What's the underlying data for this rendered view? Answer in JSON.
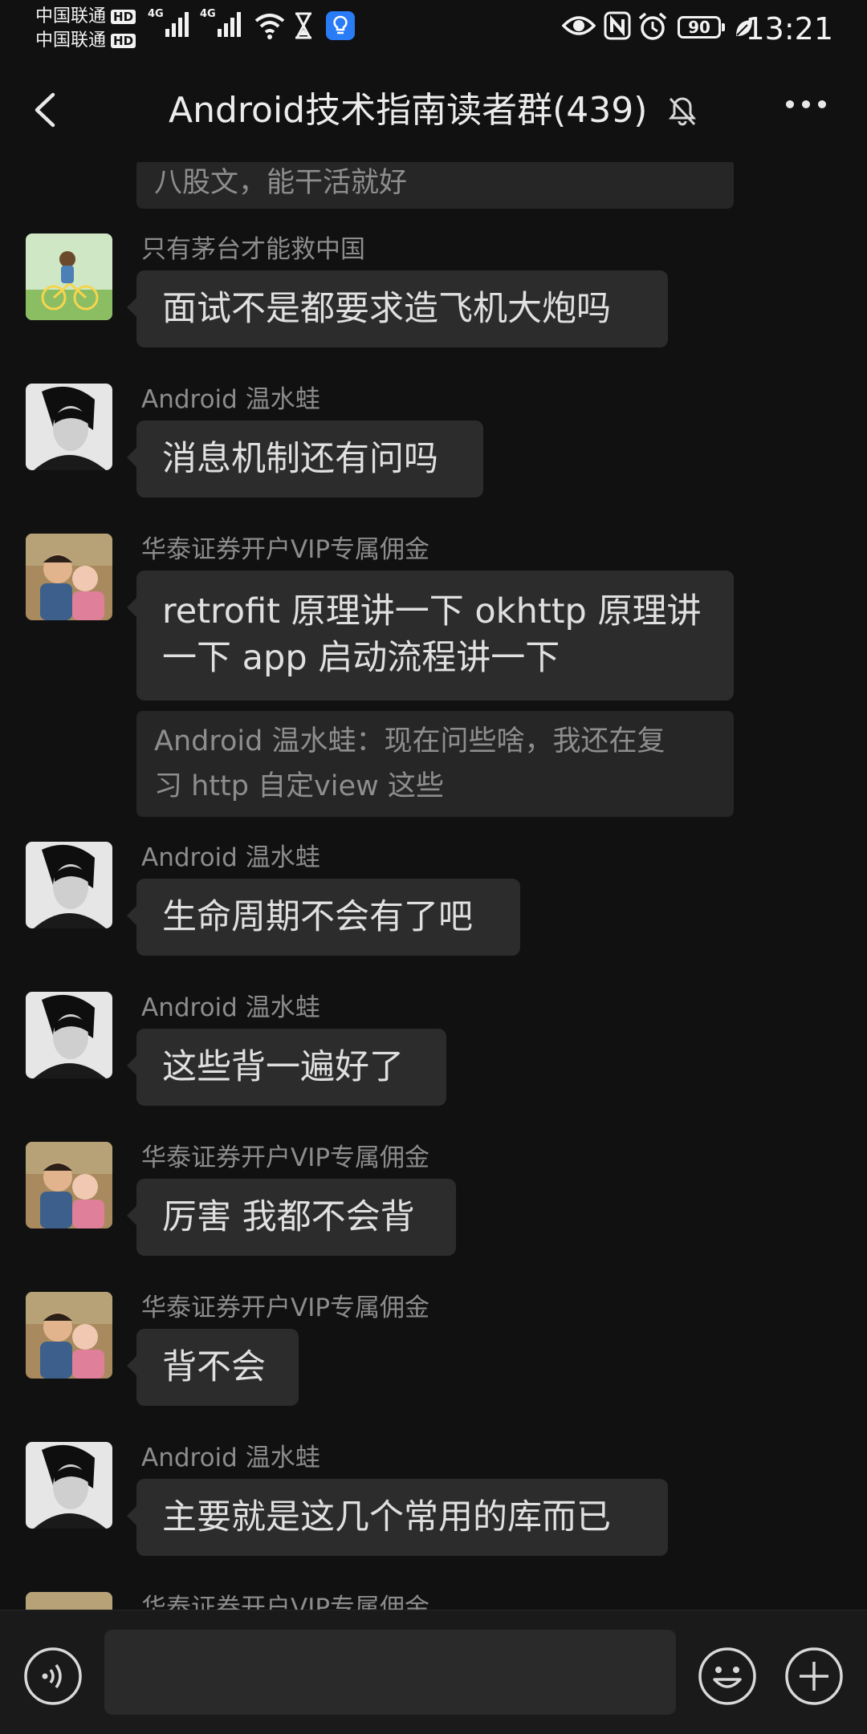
{
  "status_bar": {
    "carrier_1": "中国联通",
    "carrier_2": "中国联通",
    "hd_badge": "HD",
    "network_1": "4G",
    "network_2": "4G",
    "battery": "90",
    "time": "13:21",
    "icons": [
      "wifi-icon",
      "hourglass-icon",
      "bulb-icon",
      "eye-icon",
      "nfc-icon",
      "alarm-icon",
      "battery-icon",
      "leaf-icon"
    ]
  },
  "header": {
    "title": "Android技术指南读者群(439)",
    "icons": [
      "back-icon",
      "mute-bell-icon",
      "more-icon"
    ]
  },
  "messages": [
    {
      "type": "quote",
      "text": "八股文，能干活就好"
    },
    {
      "type": "message",
      "sender": "只有茅台才能救中国",
      "avatar": "avatar-child-bike",
      "text": "面试不是都要求造飞机大炮吗"
    },
    {
      "type": "message",
      "sender": "Android 温水蛙",
      "avatar": "avatar-bw-man",
      "text": "消息机制还有问吗"
    },
    {
      "type": "message",
      "sender": "华泰证券开户VIP专属佣金",
      "avatar": "avatar-father-baby",
      "text_line1": "retrofit 原理讲一下 okhttp 原理讲",
      "text_line2": "一下 app 启动流程讲一下"
    },
    {
      "type": "quote",
      "text_line1": "Android 温水蛙：现在问些啥，我还在复",
      "text_line2": "习 http 自定view 这些"
    },
    {
      "type": "message",
      "sender": "Android 温水蛙",
      "avatar": "avatar-bw-man",
      "text": "生命周期不会有了吧"
    },
    {
      "type": "message",
      "sender": "Android 温水蛙",
      "avatar": "avatar-bw-man",
      "text": "这些背一遍好了"
    },
    {
      "type": "message",
      "sender": "华泰证券开户VIP专属佣金",
      "avatar": "avatar-father-baby",
      "text": "厉害 我都不会背"
    },
    {
      "type": "message",
      "sender": "华泰证券开户VIP专属佣金",
      "avatar": "avatar-father-baby",
      "text": "背不会"
    },
    {
      "type": "message",
      "sender": "Android 温水蛙",
      "avatar": "avatar-bw-man",
      "text": "主要就是这几个常用的库而已"
    },
    {
      "type": "message",
      "sender": "华泰证券开户VIP专属佣金",
      "avatar": "avatar-father-baby",
      "text": ""
    }
  ],
  "input_bar": {
    "message_value": "",
    "icons": [
      "voice-icon",
      "emoji-icon",
      "plus-icon"
    ]
  }
}
